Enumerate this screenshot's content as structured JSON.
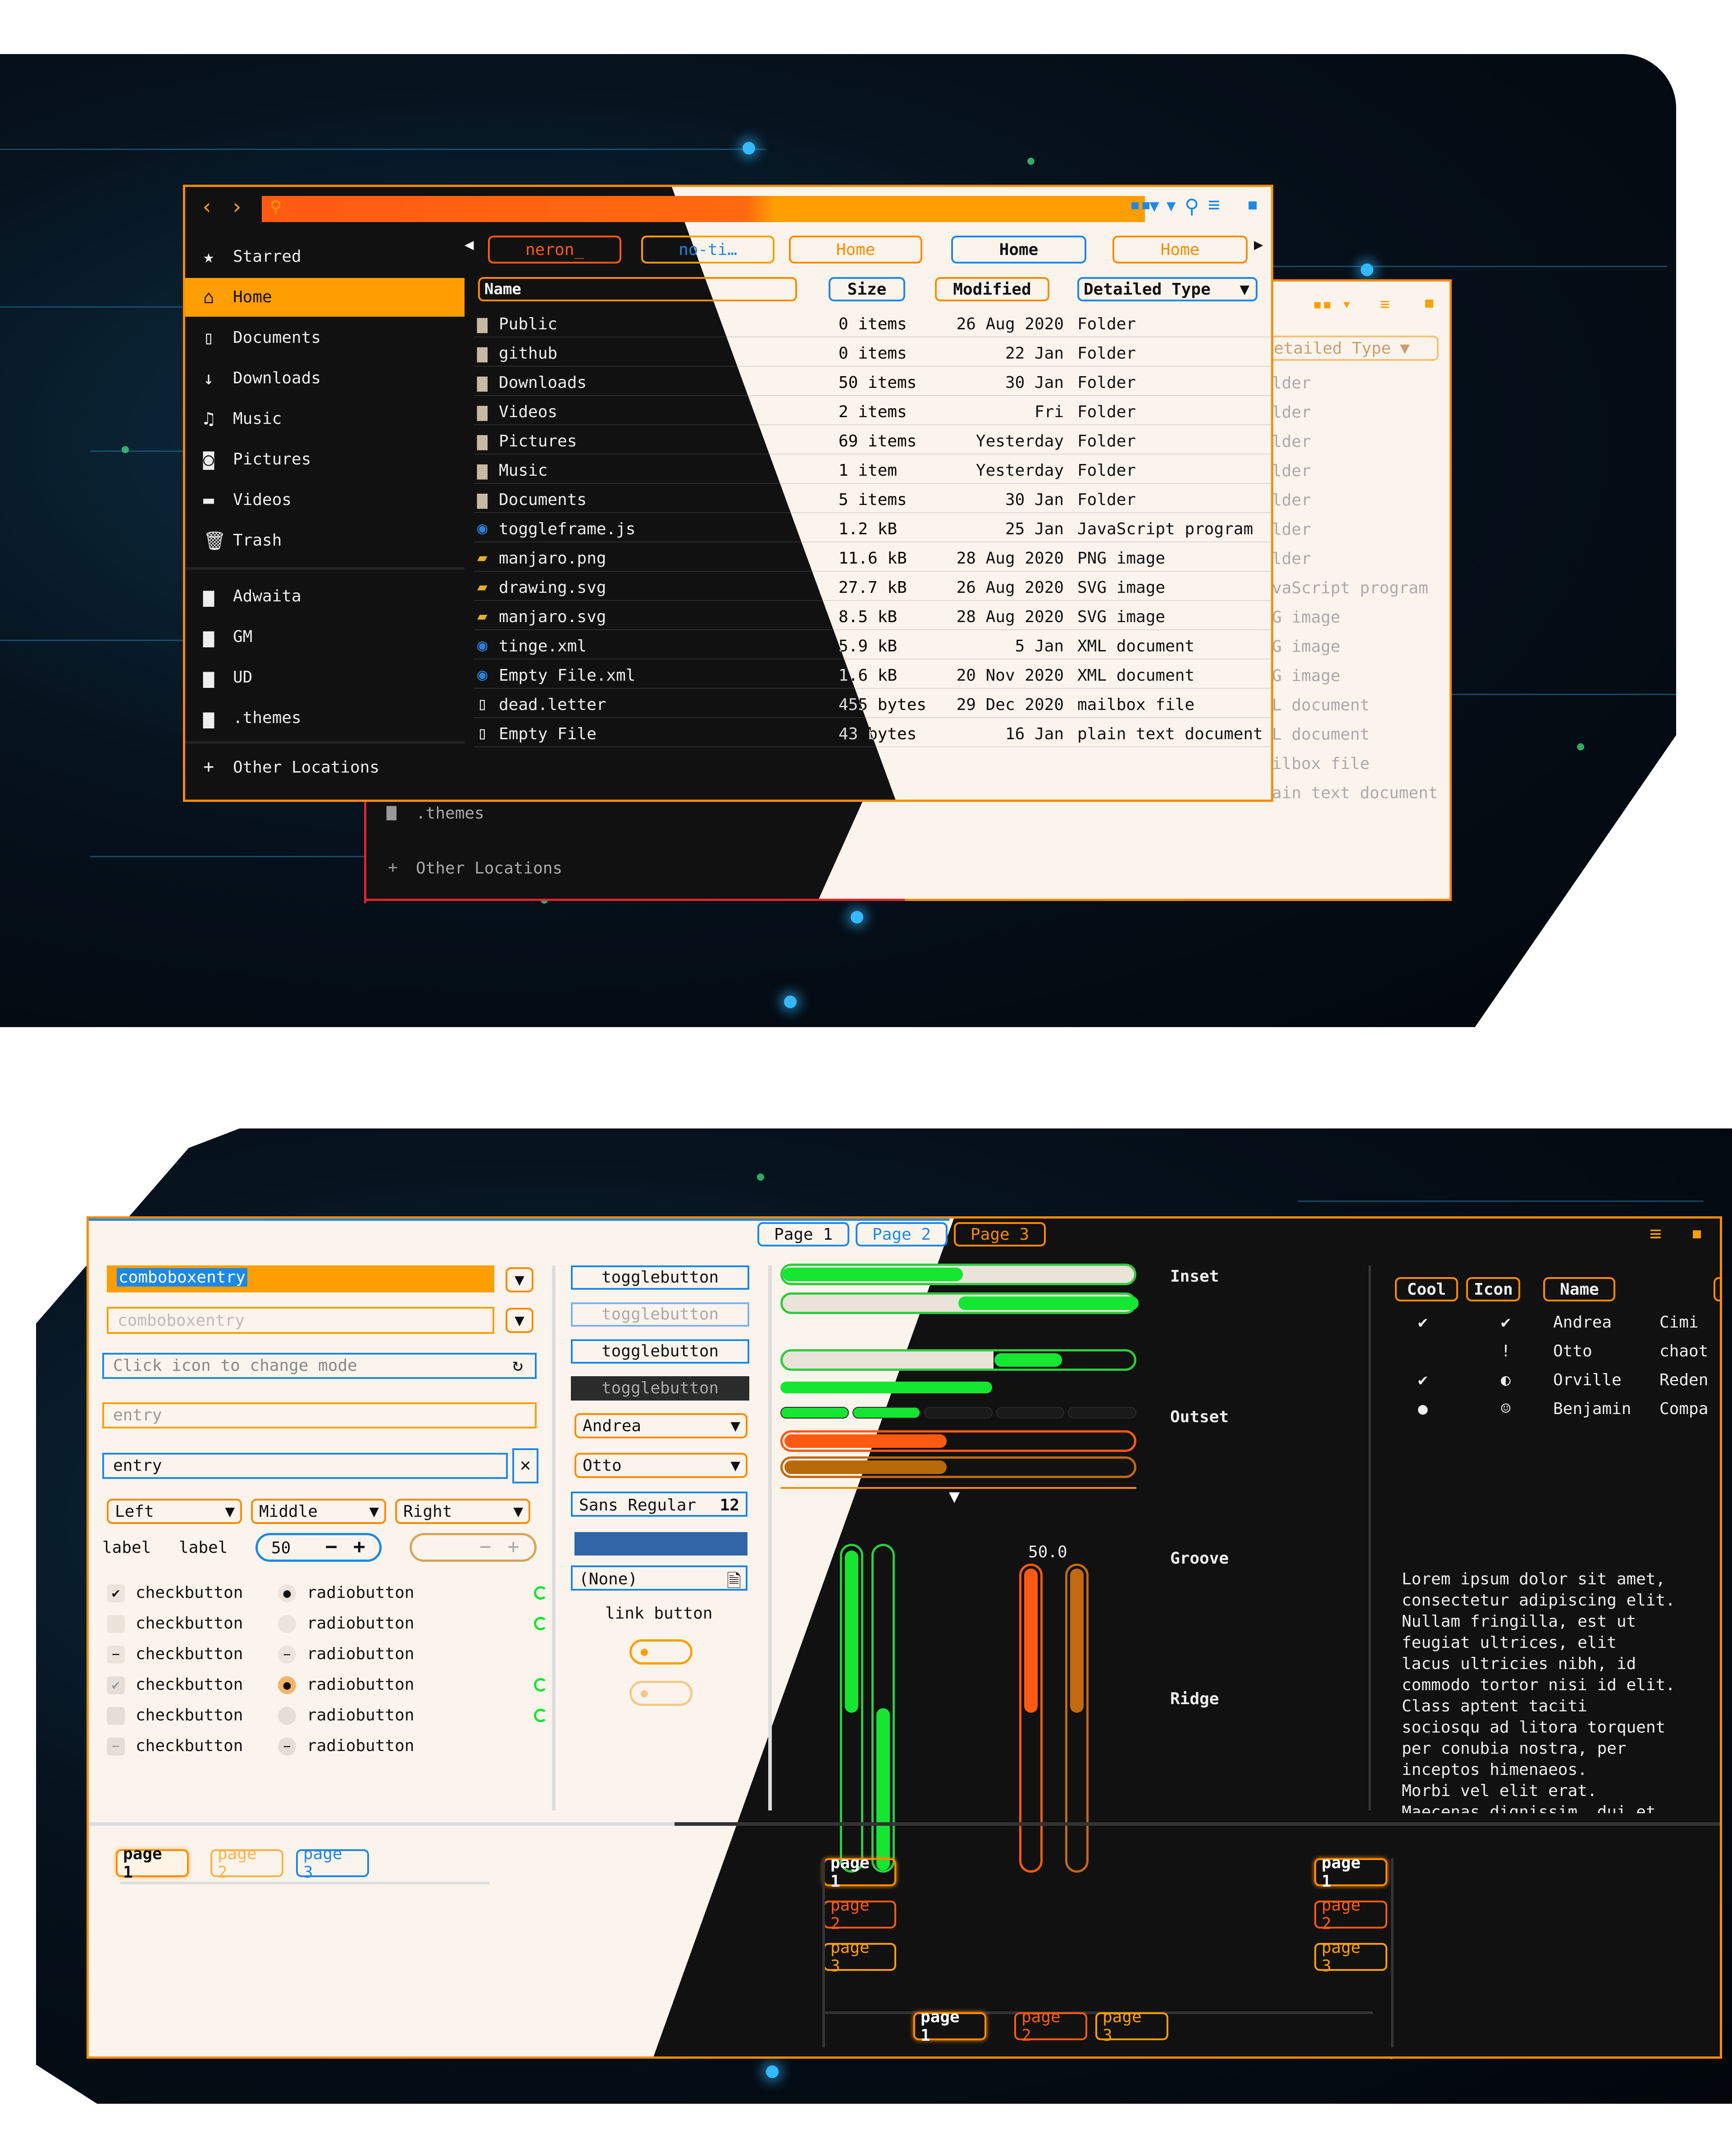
{
  "files": {
    "sidebar": {
      "places": [
        "Starred",
        "Home",
        "Documents",
        "Downloads",
        "Music",
        "Pictures",
        "Videos",
        "Trash"
      ],
      "bookmarks": [
        "Adwaita",
        "GM",
        "UD",
        ".themes"
      ],
      "other": "Other Locations",
      "back_sidebar": [
        ".themes",
        "Other Locations"
      ]
    },
    "path_tabs": [
      "neron_",
      "no-ti…",
      "Home",
      "Home",
      "Home"
    ],
    "columns": [
      "Name",
      "Size",
      "Modified",
      "Detailed Type"
    ],
    "rows": [
      {
        "name": "Public",
        "size": "0 items",
        "modified": "26 Aug 2020",
        "type": "Folder",
        "icon": "folder"
      },
      {
        "name": "github",
        "size": "0 items",
        "modified": "22 Jan",
        "type": "Folder",
        "icon": "folder"
      },
      {
        "name": "Downloads",
        "size": "50 items",
        "modified": "30 Jan",
        "type": "Folder",
        "icon": "folder"
      },
      {
        "name": "Videos",
        "size": "2 items",
        "modified": "Fri",
        "type": "Folder",
        "icon": "folder"
      },
      {
        "name": "Pictures",
        "size": "69 items",
        "modified": "Yesterday",
        "type": "Folder",
        "icon": "folder"
      },
      {
        "name": "Music",
        "size": "1 item",
        "modified": "Yesterday",
        "type": "Folder",
        "icon": "folder"
      },
      {
        "name": "Documents",
        "size": "5 items",
        "modified": "30 Jan",
        "type": "Folder",
        "icon": "folder"
      },
      {
        "name": "toggleframe.js",
        "size": "1.2 kB",
        "modified": "25 Jan",
        "type": "JavaScript program",
        "icon": "js-file"
      },
      {
        "name": "manjaro.png",
        "size": "11.6 kB",
        "modified": "28 Aug 2020",
        "type": "PNG image",
        "icon": "image-file"
      },
      {
        "name": "drawing.svg",
        "size": "27.7 kB",
        "modified": "26 Aug 2020",
        "type": "SVG image",
        "icon": "image-file"
      },
      {
        "name": "manjaro.svg",
        "size": "8.5 kB",
        "modified": "28 Aug 2020",
        "type": "SVG image",
        "icon": "image-file"
      },
      {
        "name": "tinge.xml",
        "size": "5.9 kB",
        "modified": "5 Jan",
        "type": "XML document",
        "icon": "xml-file"
      },
      {
        "name": "Empty File.xml",
        "size": "1.6 kB",
        "modified": "20 Nov 2020",
        "type": "XML document",
        "icon": "xml-file"
      },
      {
        "name": "dead.letter",
        "size": "455 bytes",
        "modified": "29 Dec 2020",
        "type": "mailbox file",
        "icon": "text-file"
      },
      {
        "name": "Empty File",
        "size": "43 bytes",
        "modified": "16 Jan",
        "type": "plain text document",
        "icon": "text-file"
      }
    ],
    "back_types": [
      "lder",
      "lder",
      "lder",
      "lder",
      "lder",
      "lder",
      "lder",
      "vaScript program",
      "G image",
      "G image",
      "G image",
      "L document",
      "L document",
      "ilbox file",
      "ain text document"
    ],
    "back_header": "etailed Type"
  },
  "widgets": {
    "notebook_tabs": [
      "Page 1",
      "Page 2",
      "Page 3"
    ],
    "comboboxentry": [
      "comboboxentry",
      "comboboxentry"
    ],
    "entry_mode_placeholder": "Click icon to change mode",
    "entry_placeholder": "entry",
    "entry_value": "entry",
    "combos": [
      "Left",
      "Middle",
      "Right"
    ],
    "labels": [
      "label",
      "label"
    ],
    "spin_value": "50",
    "checkbutton": "checkbutton",
    "radiobutton": "radiobutton",
    "togglebuttons": [
      "togglebutton",
      "togglebutton",
      "togglebutton",
      "togglebutton"
    ],
    "people_combos": [
      "Andrea",
      "Otto"
    ],
    "font_button": {
      "name": "Sans Regular",
      "size": "12"
    },
    "file_chooser": "(None)",
    "link_button": "link button",
    "progress_text": "50 %",
    "scale_value": "50.0",
    "frames": [
      "Inset",
      "Outset",
      "Groove",
      "Ridge"
    ],
    "tree_columns": [
      "Cool",
      "Icon",
      "Name",
      "Nic"
    ],
    "tree_rows": [
      {
        "name": "Andrea",
        "nick": "Cimi"
      },
      {
        "name": "Otto",
        "nick": "chaot"
      },
      {
        "name": "Orville",
        "nick": "Reden"
      },
      {
        "name": "Benjamin",
        "nick": "Compa"
      }
    ],
    "lorem": [
      "Lorem ipsum dolor sit amet,",
      "consectetur adipiscing elit.",
      "Nullam fringilla, est ut",
      "feugiat ultrices, elit",
      "lacus ultricies nibh, id",
      "commodo tortor nisi id elit.",
      "Class aptent taciti",
      "sociosqu ad litora torquent",
      "per conubia nostra, per",
      "inceptos himenaeos.",
      "Morbi vel elit erat.",
      "Maecenas dignissim, dui et"
    ],
    "pages": [
      "page 1",
      "page 2",
      "page 3"
    ]
  }
}
